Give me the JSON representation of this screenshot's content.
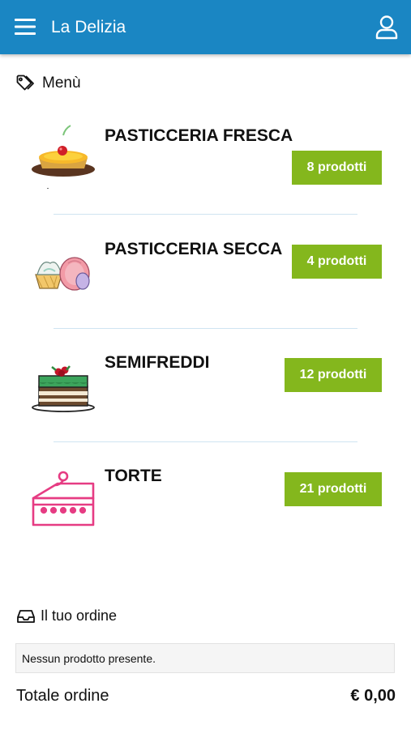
{
  "header": {
    "title": "La Delizia",
    "menu_icon": "hamburger-icon",
    "user_icon": "user-icon"
  },
  "menu_section": {
    "label": "Menù",
    "icon": "tag-icon"
  },
  "categories": [
    {
      "name": "PASTICCERIA FRESCA",
      "count": "8 prodotti",
      "icon": "fruit-tart-icon"
    },
    {
      "name": "PASTICCERIA SECCA",
      "count": "4 prodotti",
      "icon": "macaron-icon"
    },
    {
      "name": "SEMIFREDDI",
      "count": "12 prodotti",
      "icon": "layer-cake-icon"
    },
    {
      "name": "TORTE",
      "count": "21 prodotti",
      "icon": "cake-slice-icon"
    }
  ],
  "order_section": {
    "label": "Il tuo ordine",
    "icon": "inbox-icon",
    "empty_text": "Nessun prodotto presente."
  },
  "total": {
    "label": "Totale ordine",
    "value": "€ 0,00"
  },
  "colors": {
    "header": "#1a86c3",
    "badge": "#84b71d"
  }
}
